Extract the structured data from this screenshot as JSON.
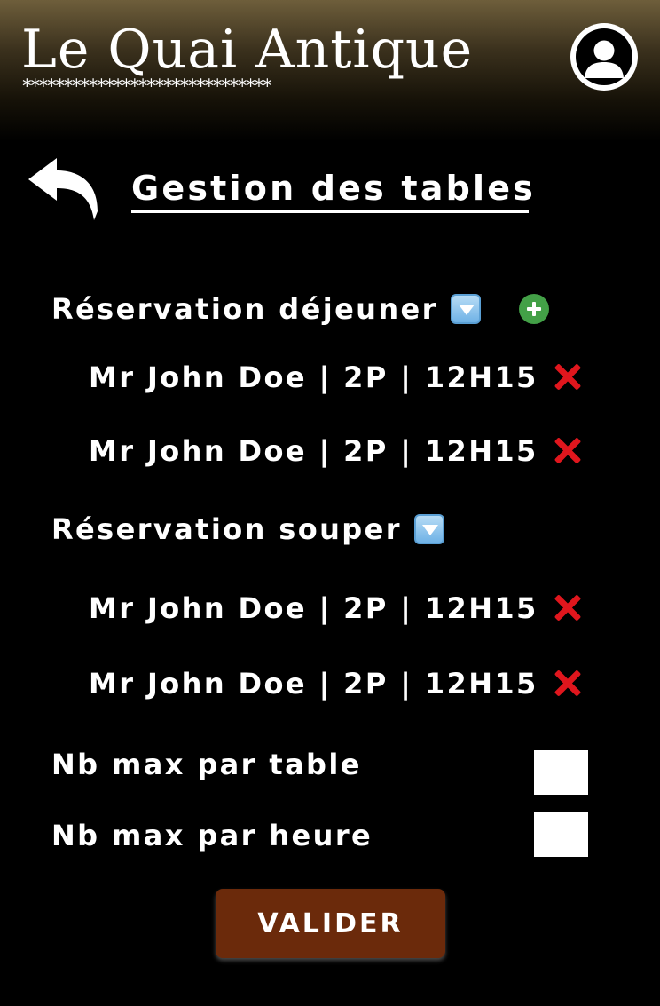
{
  "header": {
    "brand": "Le Quai Antique",
    "brand_stars": "******************************",
    "avatar_icon": "user-avatar-icon"
  },
  "page": {
    "back_icon": "back-arrow-icon",
    "title": "Gestion des tables"
  },
  "lunch": {
    "title": "Réservation déjeuner",
    "dropdown_icon": "dropdown-arrow-icon",
    "add_icon": "add-icon",
    "reservations": [
      {
        "text": "Mr John Doe | 2P | 12H15",
        "delete_icon": "delete-icon"
      },
      {
        "text": "Mr John Doe | 2P | 12H15",
        "delete_icon": "delete-icon"
      }
    ]
  },
  "dinner": {
    "title": "Réservation souper",
    "dropdown_icon": "dropdown-arrow-icon",
    "reservations": [
      {
        "text": "Mr John Doe | 2P | 12H15",
        "delete_icon": "delete-icon"
      },
      {
        "text": "Mr John Doe | 2P | 12H15",
        "delete_icon": "delete-icon"
      }
    ]
  },
  "settings": {
    "max_per_table_label": "Nb max par table",
    "max_per_table_value": "",
    "max_per_hour_label": "Nb max par heure",
    "max_per_hour_value": ""
  },
  "actions": {
    "submit_label": "VALIDER"
  },
  "colors": {
    "background": "#000000",
    "header_gradient_top": "#6e5e3b",
    "button": "#6b2a0b",
    "add_green": "#43a047",
    "delete_red": "#e0161d",
    "dropdown_blue": "#6fb2e6"
  }
}
